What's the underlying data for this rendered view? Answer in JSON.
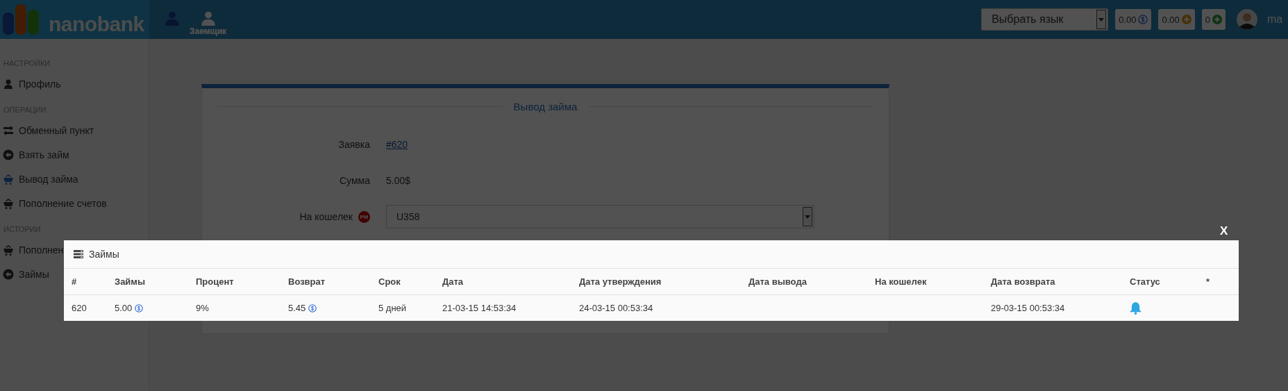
{
  "topbar": {
    "logo": "nanobank",
    "roles": [
      {
        "selected": true
      },
      {
        "label": "Заемщик",
        "selected": false
      }
    ],
    "language_select": {
      "value": "Выбрать язык"
    },
    "balances": [
      {
        "amount": "0.00",
        "kind": "dollar"
      },
      {
        "amount": "0.00",
        "kind": "gold"
      },
      {
        "amount": "0",
        "kind": "plus"
      }
    ],
    "user": {
      "name": "ma"
    }
  },
  "sidebar": {
    "sections": [
      {
        "title": "НАСТРОЙКИ",
        "items": [
          {
            "label": "Профиль",
            "kind": "user",
            "selected": false
          }
        ]
      },
      {
        "title": "ОПЕРАЦИИ",
        "items": [
          {
            "label": "Обменный пункт",
            "kind": "exchange",
            "selected": false
          },
          {
            "label": "Взять займ",
            "kind": "arrow",
            "selected": false
          },
          {
            "label": "Вывод займа",
            "kind": "basket",
            "selected": true
          },
          {
            "label": "Пополнение счетов",
            "kind": "basket",
            "selected": false
          }
        ]
      },
      {
        "title": "ИСТОРИИ",
        "items": [
          {
            "label": "Пополнен",
            "kind": "basket",
            "selected": false
          },
          {
            "label": "Займы",
            "kind": "arrow",
            "selected": false
          }
        ]
      }
    ]
  },
  "form": {
    "title": "Вывод займа",
    "fields": [
      {
        "label": "Заявка",
        "value": "#620",
        "kind": "link"
      },
      {
        "label": "Сумма",
        "value": "5.00$",
        "kind": "text"
      },
      {
        "label": "На кошелек",
        "badge": "PM",
        "value": "U358",
        "kind": "select"
      }
    ]
  },
  "modal": {
    "close": "X",
    "title": "Займы",
    "table": {
      "columns": [
        "#",
        "Займы",
        "Процент",
        "Возврат",
        "Срок",
        "Дата",
        "Дата утверждения",
        "Дата вывода",
        "На кошелек",
        "Дата возврата",
        "Статус",
        "*"
      ],
      "rows": [
        {
          "number": "620",
          "loan": "5.00",
          "percent": "9%",
          "return": "5.45",
          "term": "5 дней",
          "date": "21-03-15 14:53:34",
          "approved": "24-03-15 00:53:34",
          "return_date": "29-03-15 00:53:34",
          "status": {
            "kind": "bell"
          }
        }
      ]
    }
  }
}
